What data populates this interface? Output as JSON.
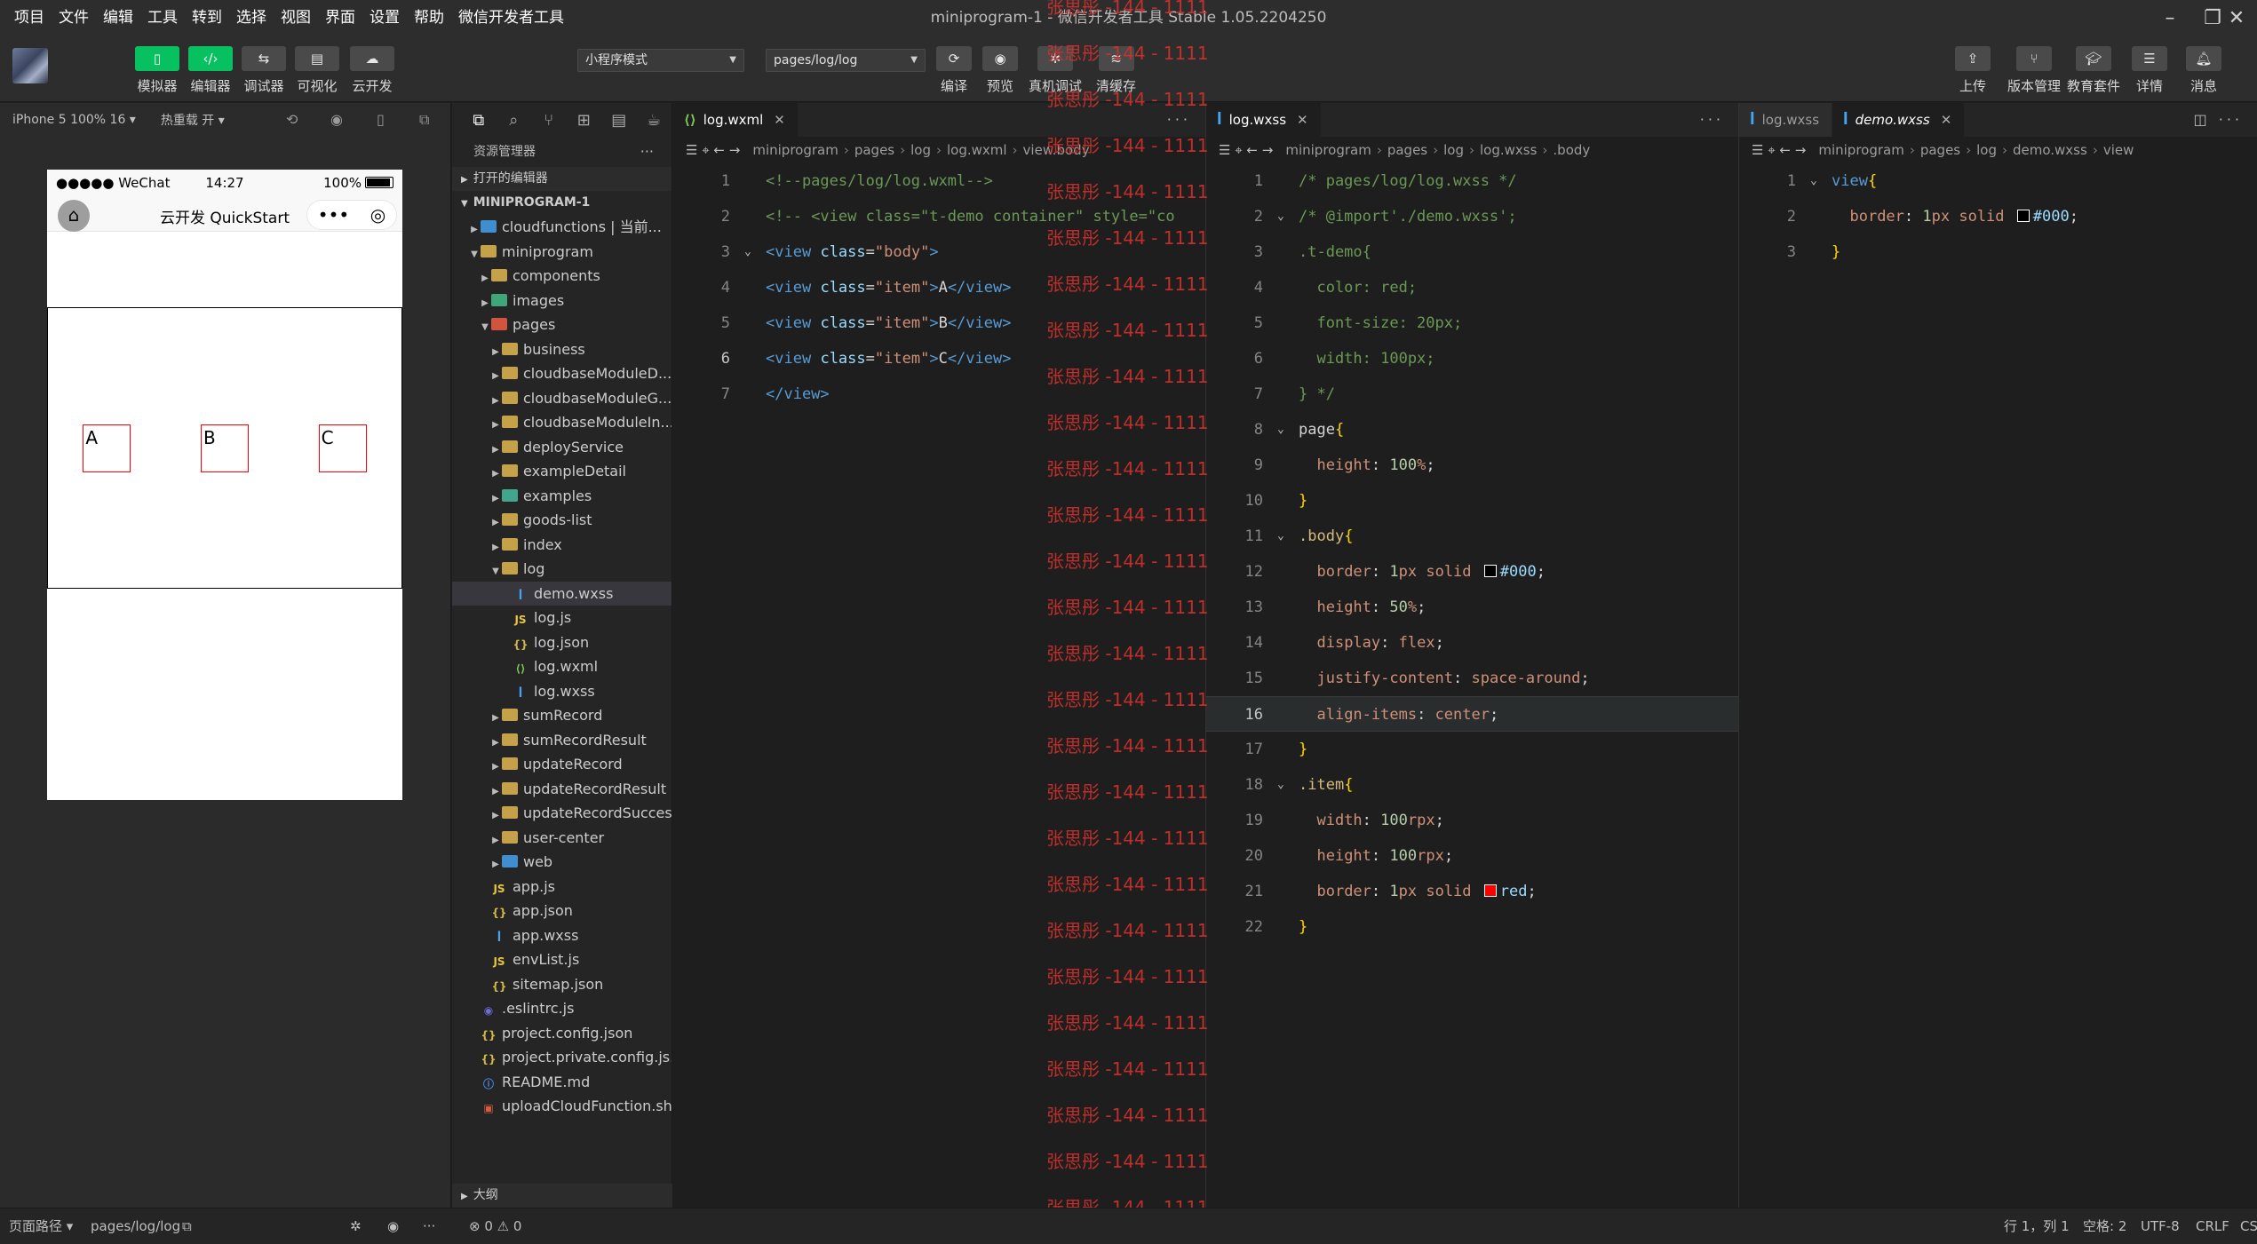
{
  "menubar": {
    "items": [
      "项目",
      "文件",
      "编辑",
      "工具",
      "转到",
      "选择",
      "视图",
      "界面",
      "设置",
      "帮助",
      "微信开发者工具"
    ],
    "window_title": "miniprogram-1 - 微信开发者工具 Stable 1.05.2204250"
  },
  "toolbar": {
    "left_buttons": [
      {
        "label": "模拟器",
        "icon": "phone-icon"
      },
      {
        "label": "编辑器",
        "icon": "code-icon"
      },
      {
        "label": "调试器",
        "icon": "debug-icon"
      },
      {
        "label": "可视化",
        "icon": "layout-icon"
      },
      {
        "label": "云开发",
        "icon": "cloud-icon"
      }
    ],
    "mode_select": "小程序模式",
    "page_select": "pages/log/log",
    "center_buttons": [
      {
        "label": "编译",
        "icon": "refresh-icon"
      },
      {
        "label": "预览",
        "icon": "eye-icon"
      },
      {
        "label": "真机调试",
        "icon": "bug-icon"
      },
      {
        "label": "清缓存",
        "icon": "layers-icon"
      }
    ],
    "right_buttons": [
      {
        "label": "上传",
        "icon": "upload-icon"
      },
      {
        "label": "版本管理",
        "icon": "branch-icon"
      },
      {
        "label": "教育套件",
        "icon": "graduation-icon"
      },
      {
        "label": "详情",
        "icon": "menu-icon"
      },
      {
        "label": "消息",
        "icon": "bell-icon"
      }
    ]
  },
  "simulator": {
    "device": "iPhone 5 100% 16 ▾",
    "hot_reload": "热重载 开 ▾",
    "status_left": "●●●●● WeChat",
    "status_time": "14:27",
    "status_battery": "100%",
    "nav_title": "云开发 QuickStart",
    "items": [
      "A",
      "B",
      "C"
    ]
  },
  "explorer": {
    "title": "资源管理器",
    "open_editors": "打开的编辑器",
    "project": "MINIPROGRAM-1",
    "outline": "大纲",
    "tree": [
      {
        "name": "cloudfunctions | 当前...",
        "depth": 1,
        "type": "folder-blue",
        "arrow": "right"
      },
      {
        "name": "miniprogram",
        "depth": 1,
        "type": "folder",
        "arrow": "down"
      },
      {
        "name": "components",
        "depth": 2,
        "type": "folder",
        "arrow": "right"
      },
      {
        "name": "images",
        "depth": 2,
        "type": "folder-green",
        "arrow": "right"
      },
      {
        "name": "pages",
        "depth": 2,
        "type": "folder-red",
        "arrow": "down"
      },
      {
        "name": "business",
        "depth": 3,
        "type": "folder",
        "arrow": "right"
      },
      {
        "name": "cloudbaseModuleD...",
        "depth": 3,
        "type": "folder",
        "arrow": "right"
      },
      {
        "name": "cloudbaseModuleG...",
        "depth": 3,
        "type": "folder",
        "arrow": "right"
      },
      {
        "name": "cloudbaseModuleIn...",
        "depth": 3,
        "type": "folder",
        "arrow": "right"
      },
      {
        "name": "deployService",
        "depth": 3,
        "type": "folder",
        "arrow": "right"
      },
      {
        "name": "exampleDetail",
        "depth": 3,
        "type": "folder",
        "arrow": "right"
      },
      {
        "name": "examples",
        "depth": 3,
        "type": "folder-teal",
        "arrow": "right"
      },
      {
        "name": "goods-list",
        "depth": 3,
        "type": "folder",
        "arrow": "right"
      },
      {
        "name": "index",
        "depth": 3,
        "type": "folder",
        "arrow": "right"
      },
      {
        "name": "log",
        "depth": 3,
        "type": "folder",
        "arrow": "down"
      },
      {
        "name": "demo.wxss",
        "depth": 4,
        "type": "css",
        "arrow": "",
        "selected": true
      },
      {
        "name": "log.js",
        "depth": 4,
        "type": "js",
        "arrow": ""
      },
      {
        "name": "log.json",
        "depth": 4,
        "type": "json",
        "arrow": ""
      },
      {
        "name": "log.wxml",
        "depth": 4,
        "type": "wxml",
        "arrow": ""
      },
      {
        "name": "log.wxss",
        "depth": 4,
        "type": "css",
        "arrow": ""
      },
      {
        "name": "sumRecord",
        "depth": 3,
        "type": "folder",
        "arrow": "right"
      },
      {
        "name": "sumRecordResult",
        "depth": 3,
        "type": "folder",
        "arrow": "right"
      },
      {
        "name": "updateRecord",
        "depth": 3,
        "type": "folder",
        "arrow": "right"
      },
      {
        "name": "updateRecordResult",
        "depth": 3,
        "type": "folder",
        "arrow": "right"
      },
      {
        "name": "updateRecordSuccess",
        "depth": 3,
        "type": "folder",
        "arrow": "right"
      },
      {
        "name": "user-center",
        "depth": 3,
        "type": "folder",
        "arrow": "right"
      },
      {
        "name": "web",
        "depth": 3,
        "type": "folder-blue",
        "arrow": "right"
      },
      {
        "name": "app.js",
        "depth": 2,
        "type": "js",
        "arrow": ""
      },
      {
        "name": "app.json",
        "depth": 2,
        "type": "json",
        "arrow": ""
      },
      {
        "name": "app.wxss",
        "depth": 2,
        "type": "css",
        "arrow": ""
      },
      {
        "name": "envList.js",
        "depth": 2,
        "type": "js",
        "arrow": ""
      },
      {
        "name": "sitemap.json",
        "depth": 2,
        "type": "json",
        "arrow": ""
      },
      {
        "name": ".eslintrc.js",
        "depth": 1,
        "type": "eslint",
        "arrow": ""
      },
      {
        "name": "project.config.json",
        "depth": 1,
        "type": "json",
        "arrow": ""
      },
      {
        "name": "project.private.config.js...",
        "depth": 1,
        "type": "json",
        "arrow": ""
      },
      {
        "name": "README.md",
        "depth": 1,
        "type": "info",
        "arrow": ""
      },
      {
        "name": "uploadCloudFunction.sh",
        "depth": 1,
        "type": "sh",
        "arrow": ""
      }
    ]
  },
  "editor1": {
    "tab": "log.wxml",
    "breadcrumb": [
      "miniprogram",
      "pages",
      "log",
      "log.wxml",
      "view.body"
    ],
    "current_line": 6,
    "lines": [
      [
        {
          "t": "<!--pages/log/log.wxml-->",
          "c": "comment"
        }
      ],
      [
        {
          "t": "<!-- <view class=\"t-demo container\" style=\"co",
          "c": "comment"
        }
      ],
      [
        {
          "t": "<",
          "c": "tag"
        },
        {
          "t": "view",
          "c": "tag"
        },
        {
          "t": " ",
          "c": "text"
        },
        {
          "t": "class",
          "c": "attr"
        },
        {
          "t": "=",
          "c": "text"
        },
        {
          "t": "\"body\"",
          "c": "str"
        },
        {
          "t": ">",
          "c": "tag"
        }
      ],
      [
        {
          "t": "<",
          "c": "tag"
        },
        {
          "t": "view",
          "c": "tag"
        },
        {
          "t": " ",
          "c": "text"
        },
        {
          "t": "class",
          "c": "attr"
        },
        {
          "t": "=",
          "c": "text"
        },
        {
          "t": "\"item\"",
          "c": "str"
        },
        {
          "t": ">",
          "c": "tag"
        },
        {
          "t": "A",
          "c": "text"
        },
        {
          "t": "</view>",
          "c": "tag"
        }
      ],
      [
        {
          "t": "<",
          "c": "tag"
        },
        {
          "t": "view",
          "c": "tag"
        },
        {
          "t": " ",
          "c": "text"
        },
        {
          "t": "class",
          "c": "attr"
        },
        {
          "t": "=",
          "c": "text"
        },
        {
          "t": "\"item\"",
          "c": "str"
        },
        {
          "t": ">",
          "c": "tag"
        },
        {
          "t": "B",
          "c": "text"
        },
        {
          "t": "</view>",
          "c": "tag"
        }
      ],
      [
        {
          "t": "<",
          "c": "tag"
        },
        {
          "t": "view",
          "c": "tag"
        },
        {
          "t": " ",
          "c": "text"
        },
        {
          "t": "class",
          "c": "attr"
        },
        {
          "t": "=",
          "c": "text"
        },
        {
          "t": "\"item\"",
          "c": "str"
        },
        {
          "t": ">",
          "c": "tag"
        },
        {
          "t": "C",
          "c": "text"
        },
        {
          "t": "</view>",
          "c": "tag"
        }
      ],
      [
        {
          "t": "</view>",
          "c": "tag"
        }
      ]
    ],
    "folds": [
      3
    ]
  },
  "editor2": {
    "tab": "log.wxss",
    "breadcrumb": [
      "miniprogram",
      "pages",
      "log",
      "log.wxss",
      ".body"
    ],
    "current_line": 16,
    "lines": [
      [
        {
          "t": "/* pages/log/log.wxss */",
          "c": "comment"
        }
      ],
      [
        {
          "t": "/* @import'./demo.wxss';",
          "c": "comment"
        }
      ],
      [
        {
          "t": ".t-demo{",
          "c": "comment"
        }
      ],
      [
        {
          "t": "  color: red;",
          "c": "comment"
        }
      ],
      [
        {
          "t": "  font-size: 20px;",
          "c": "comment"
        }
      ],
      [
        {
          "t": "  width: 100px;",
          "c": "comment"
        }
      ],
      [
        {
          "t": "} */",
          "c": "comment"
        }
      ],
      [
        {
          "t": "page",
          "c": "text"
        },
        {
          "t": "{",
          "c": "brace"
        }
      ],
      [
        {
          "t": "  ",
          "c": "text"
        },
        {
          "t": "height",
          "c": "val"
        },
        {
          "t": ": ",
          "c": "punc"
        },
        {
          "t": "100",
          "c": "num"
        },
        {
          "t": "%",
          "c": "val"
        },
        {
          "t": ";",
          "c": "punc"
        }
      ],
      [
        {
          "t": "}",
          "c": "brace"
        }
      ],
      [
        {
          "t": ".body",
          "c": "sel"
        },
        {
          "t": "{",
          "c": "brace"
        }
      ],
      [
        {
          "t": "  ",
          "c": "text"
        },
        {
          "t": "border",
          "c": "val"
        },
        {
          "t": ": ",
          "c": "punc"
        },
        {
          "t": "1",
          "c": "num"
        },
        {
          "t": "px solid ",
          "c": "val"
        },
        {
          "t": "#000",
          "c": "swatch-black"
        },
        {
          "t": ";",
          "c": "punc"
        }
      ],
      [
        {
          "t": "  ",
          "c": "text"
        },
        {
          "t": "height",
          "c": "val"
        },
        {
          "t": ": ",
          "c": "punc"
        },
        {
          "t": "50",
          "c": "num"
        },
        {
          "t": "%",
          "c": "val"
        },
        {
          "t": ";",
          "c": "punc"
        }
      ],
      [
        {
          "t": "  ",
          "c": "text"
        },
        {
          "t": "display",
          "c": "val"
        },
        {
          "t": ": ",
          "c": "punc"
        },
        {
          "t": "flex",
          "c": "val"
        },
        {
          "t": ";",
          "c": "punc"
        }
      ],
      [
        {
          "t": "  ",
          "c": "text"
        },
        {
          "t": "justify-content",
          "c": "val"
        },
        {
          "t": ": ",
          "c": "punc"
        },
        {
          "t": "space-around",
          "c": "val"
        },
        {
          "t": ";",
          "c": "punc"
        }
      ],
      [
        {
          "t": "  ",
          "c": "text"
        },
        {
          "t": "align-items",
          "c": "val"
        },
        {
          "t": ": ",
          "c": "punc"
        },
        {
          "t": "center",
          "c": "val"
        },
        {
          "t": ";",
          "c": "punc"
        }
      ],
      [
        {
          "t": "}",
          "c": "brace"
        }
      ],
      [
        {
          "t": ".item",
          "c": "sel"
        },
        {
          "t": "{",
          "c": "brace"
        }
      ],
      [
        {
          "t": "  ",
          "c": "text"
        },
        {
          "t": "width",
          "c": "val"
        },
        {
          "t": ": ",
          "c": "punc"
        },
        {
          "t": "100",
          "c": "num"
        },
        {
          "t": "rpx",
          "c": "val"
        },
        {
          "t": ";",
          "c": "punc"
        }
      ],
      [
        {
          "t": "  ",
          "c": "text"
        },
        {
          "t": "height",
          "c": "val"
        },
        {
          "t": ": ",
          "c": "punc"
        },
        {
          "t": "100",
          "c": "num"
        },
        {
          "t": "rpx",
          "c": "val"
        },
        {
          "t": ";",
          "c": "punc"
        }
      ],
      [
        {
          "t": "  ",
          "c": "text"
        },
        {
          "t": "border",
          "c": "val"
        },
        {
          "t": ": ",
          "c": "punc"
        },
        {
          "t": "1",
          "c": "num"
        },
        {
          "t": "px solid ",
          "c": "val"
        },
        {
          "t": "red",
          "c": "swatch-red"
        },
        {
          "t": ";",
          "c": "punc"
        }
      ],
      [
        {
          "t": "}",
          "c": "brace"
        }
      ]
    ],
    "folds": [
      2,
      8,
      11,
      18
    ]
  },
  "editor3": {
    "tabs": [
      "log.wxss",
      "demo.wxss"
    ],
    "breadcrumb": [
      "miniprogram",
      "pages",
      "log",
      "demo.wxss",
      "view"
    ],
    "lines": [
      [
        {
          "t": "view",
          "c": "tag"
        },
        {
          "t": "{",
          "c": "brace"
        }
      ],
      [
        {
          "t": "  ",
          "c": "text"
        },
        {
          "t": "border",
          "c": "val"
        },
        {
          "t": ": ",
          "c": "punc"
        },
        {
          "t": "1",
          "c": "num"
        },
        {
          "t": "px solid ",
          "c": "val"
        },
        {
          "t": "#000",
          "c": "swatch-black"
        },
        {
          "t": ";",
          "c": "punc"
        }
      ],
      [
        {
          "t": "}",
          "c": "brace"
        }
      ]
    ],
    "folds": [
      1
    ]
  },
  "watermark": "张思彤 -144 - 1111",
  "statusbar": {
    "page_path_label": "页面路径 ▾",
    "page_path": "pages/log/log",
    "problems": "⊗ 0 ⚠ 0",
    "cursor": "行 1，列 1",
    "spaces": "空格: 2",
    "encoding": "UTF-8",
    "eol": "CRLF",
    "lang": "CS"
  },
  "colors": {
    "accent_green": "#07c160",
    "editor_bg": "#1e1e1e",
    "watermark_red": "#d0312d"
  }
}
